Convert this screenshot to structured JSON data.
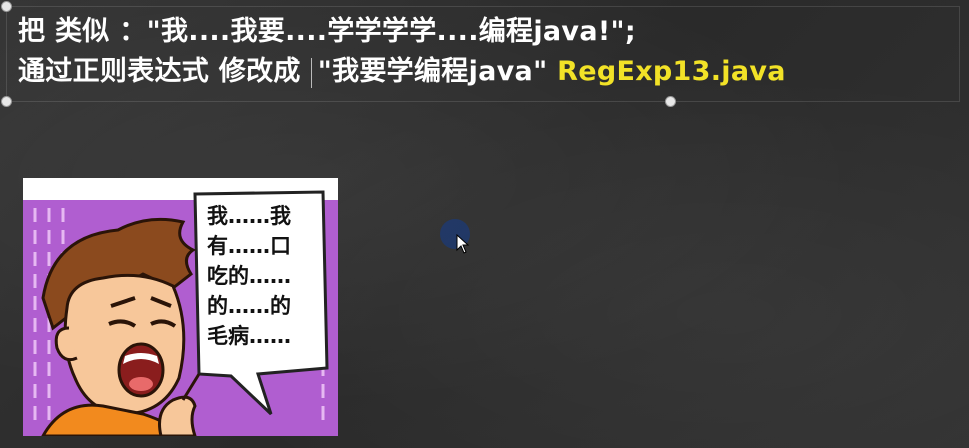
{
  "slide": {
    "line1": "把 类似 ：\"我....我要....学学学学....编程java!\";",
    "line2_prefix": "通过正则表达式 修改成",
    "line2_quote": "\"我要学编程java\"",
    "line2_file": "RegExp13.java"
  },
  "comic": {
    "speech_lines": [
      "我……我",
      "有……口",
      "吃的……",
      "的……的",
      "毛病……"
    ]
  },
  "colors": {
    "background": "#2f2f2f",
    "text": "#ffffff",
    "filename_accent": "#f2e227",
    "comic_purple": "#b05ed0"
  },
  "icons": {
    "cursor": "mouse-pointer-icon"
  }
}
